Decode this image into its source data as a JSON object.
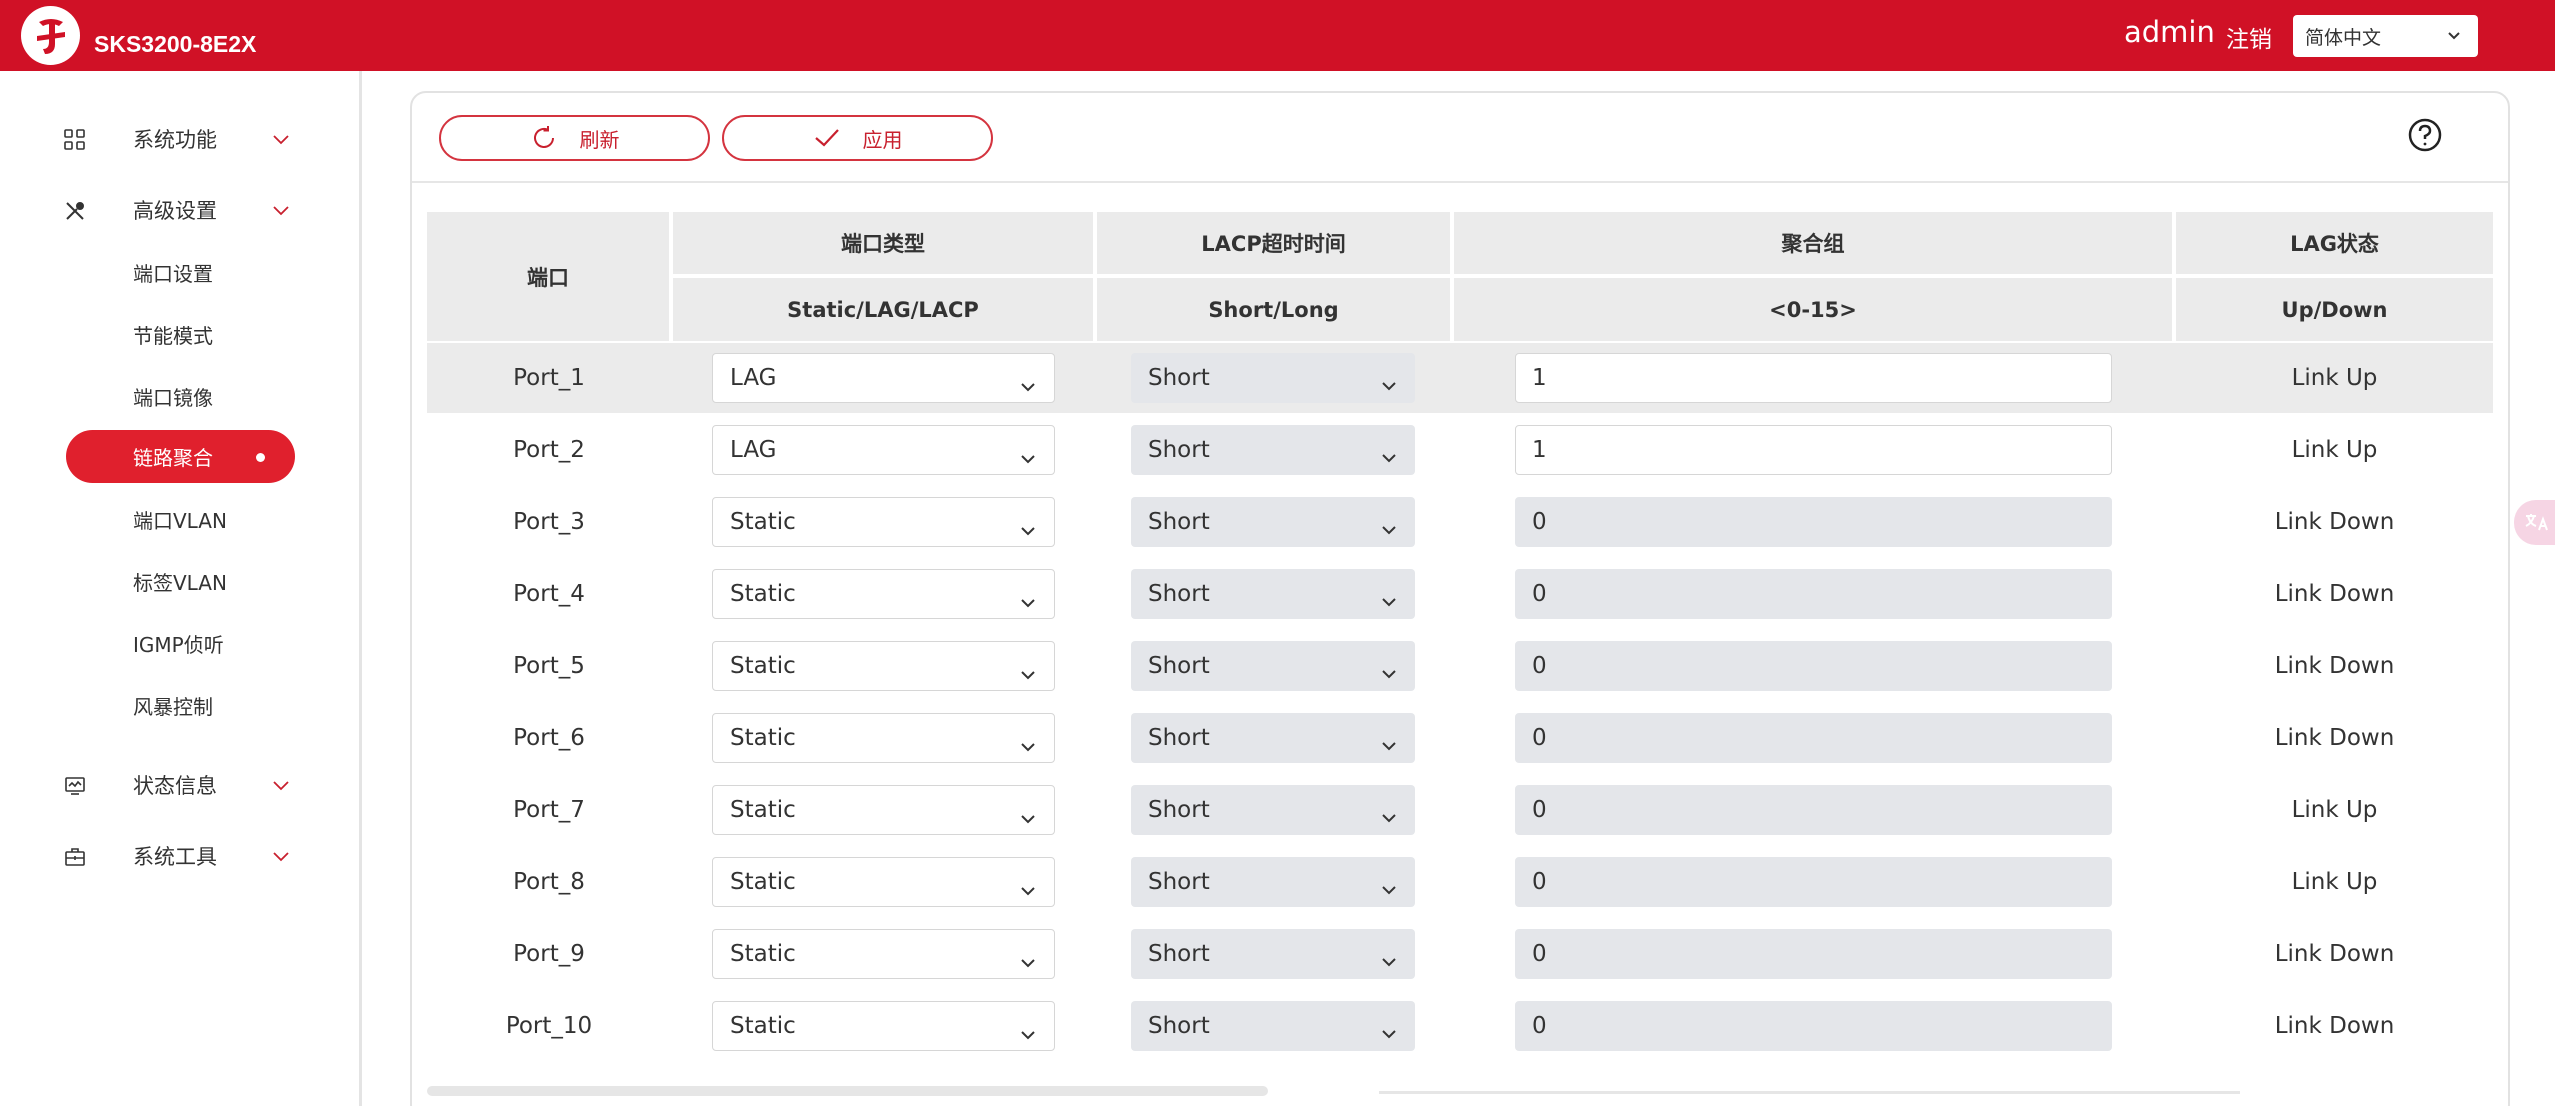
{
  "header": {
    "device_name": "SKS3200-8E2X",
    "user": "admin",
    "logout_label": "注销",
    "language": "简体中文"
  },
  "sidebar": {
    "groups": [
      {
        "label": "系统功能",
        "icon": "grid-icon"
      },
      {
        "label": "高级设置",
        "icon": "tools-icon"
      },
      {
        "label": "状态信息",
        "icon": "monitor-icon"
      },
      {
        "label": "系统工具",
        "icon": "toolbox-icon"
      }
    ],
    "items": [
      {
        "label": "端口设置"
      },
      {
        "label": "节能模式"
      },
      {
        "label": "端口镜像"
      },
      {
        "label": "链路聚合",
        "active": true
      },
      {
        "label": "端口VLAN"
      },
      {
        "label": "标签VLAN"
      },
      {
        "label": "IGMP侦听"
      },
      {
        "label": "风暴控制"
      }
    ]
  },
  "toolbar": {
    "refresh_label": "刷新",
    "apply_label": "应用"
  },
  "table": {
    "headers": {
      "port": "端口",
      "type": "端口类型",
      "type_sub": "Static/LAG/LACP",
      "timeout": "LACP超时时间",
      "timeout_sub": "Short/Long",
      "group": "聚合组",
      "group_sub": "<0-15>",
      "state": "LAG状态",
      "state_sub": "Up/Down"
    },
    "rows": [
      {
        "port": "Port_1",
        "type": "LAG",
        "timeout": "Short",
        "group": "1",
        "state": "Link Up"
      },
      {
        "port": "Port_2",
        "type": "LAG",
        "timeout": "Short",
        "group": "1",
        "state": "Link Up"
      },
      {
        "port": "Port_3",
        "type": "Static",
        "timeout": "Short",
        "group": "0",
        "state": "Link Down"
      },
      {
        "port": "Port_4",
        "type": "Static",
        "timeout": "Short",
        "group": "0",
        "state": "Link Down"
      },
      {
        "port": "Port_5",
        "type": "Static",
        "timeout": "Short",
        "group": "0",
        "state": "Link Down"
      },
      {
        "port": "Port_6",
        "type": "Static",
        "timeout": "Short",
        "group": "0",
        "state": "Link Down"
      },
      {
        "port": "Port_7",
        "type": "Static",
        "timeout": "Short",
        "group": "0",
        "state": "Link Up"
      },
      {
        "port": "Port_8",
        "type": "Static",
        "timeout": "Short",
        "group": "0",
        "state": "Link Up"
      },
      {
        "port": "Port_9",
        "type": "Static",
        "timeout": "Short",
        "group": "0",
        "state": "Link Down"
      },
      {
        "port": "Port_10",
        "type": "Static",
        "timeout": "Short",
        "group": "0",
        "state": "Link Down"
      }
    ]
  },
  "colors": {
    "brand_red": "#d01126",
    "active_red": "#e0202d"
  }
}
